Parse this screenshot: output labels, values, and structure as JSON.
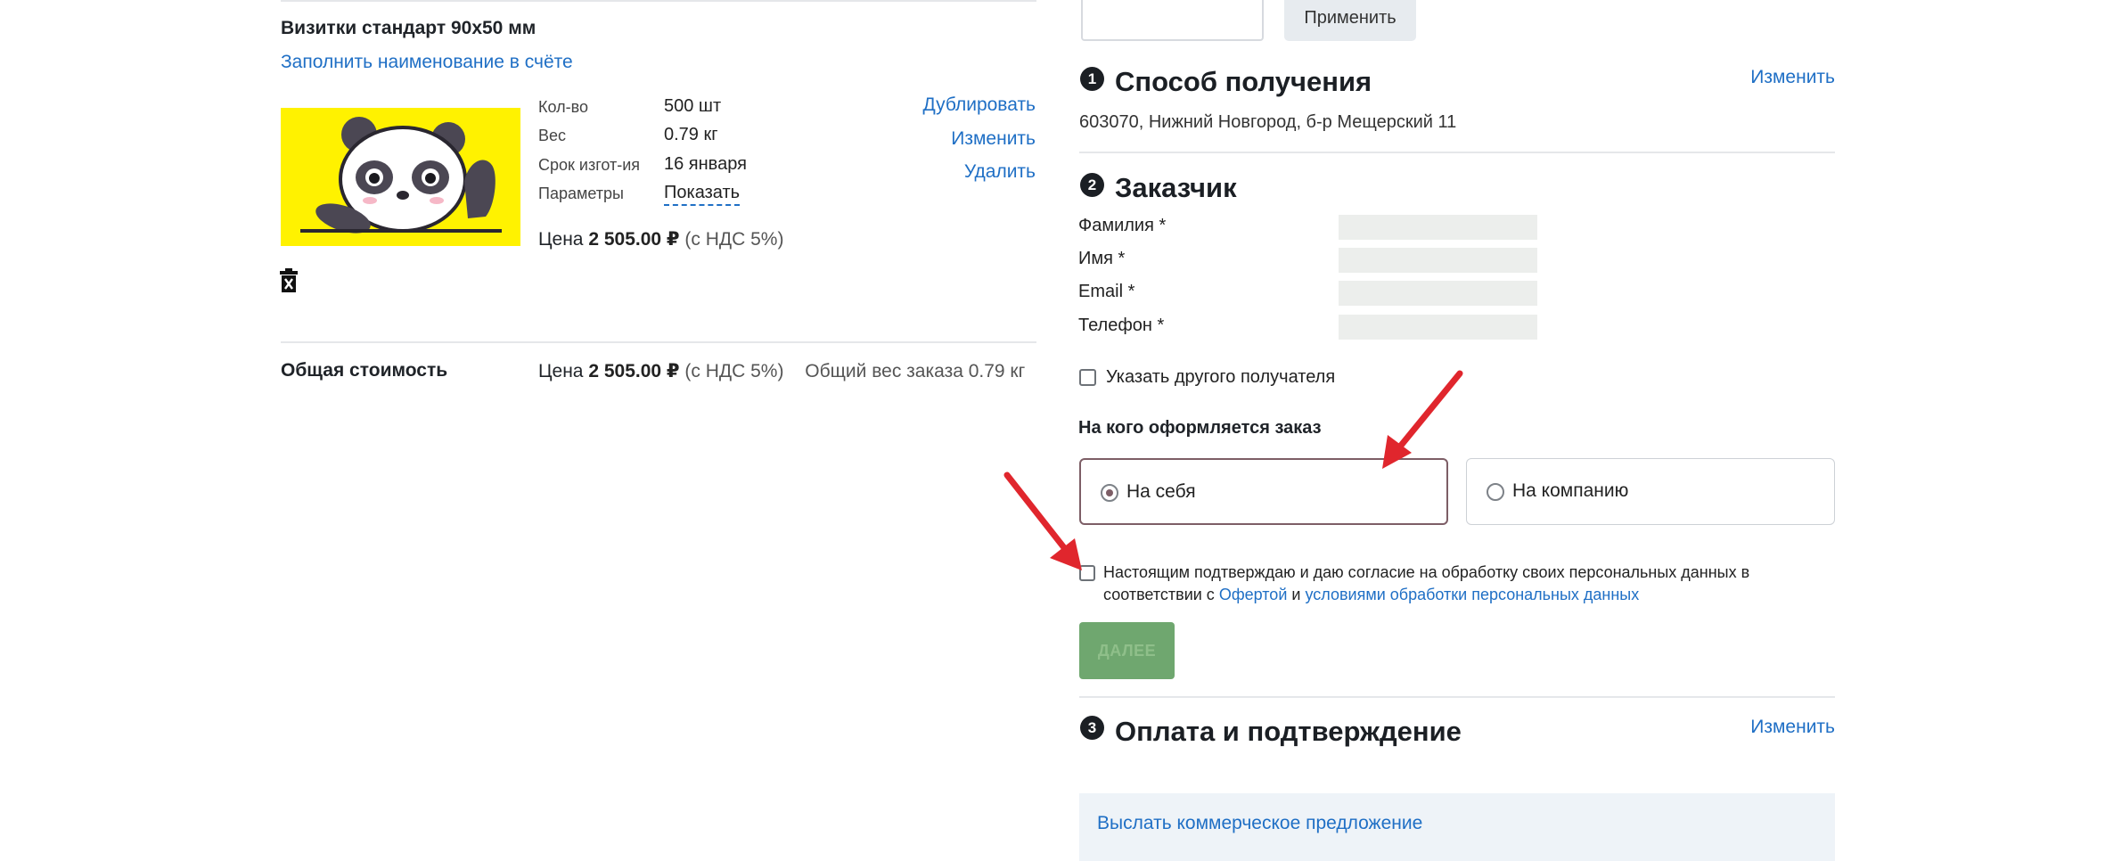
{
  "product": {
    "title": "Визитки стандарт 90х50 мм",
    "fill_name_link": "Заполнить наименование в счёте",
    "props": [
      {
        "label": "Кол-во",
        "value": "500 шт"
      },
      {
        "label": "Вес",
        "value": "0.79 кг"
      },
      {
        "label": "Срок изгот-ия",
        "value": "16 января"
      },
      {
        "label": "Параметры",
        "value": "Показать"
      }
    ],
    "actions": {
      "duplicate": "Дублировать",
      "edit": "Изменить",
      "delete": "Удалить"
    },
    "price_label": "Цена",
    "price_value": "2 505.00 ₽",
    "vat_note": "(с НДС 5%)"
  },
  "total": {
    "label": "Общая стоимость",
    "price_label": "Цена",
    "price_value": "2 505.00 ₽",
    "vat_note": "(с НДС 5%)",
    "weight_note": "Общий вес заказа 0.79 кг"
  },
  "promo": {
    "apply_button": "Применить"
  },
  "steps": [
    {
      "number": "1",
      "title": "Способ получения",
      "change_link": "Изменить"
    },
    {
      "number": "2",
      "title": "Заказчик"
    },
    {
      "number": "3",
      "title": "Оплата и подтверждение",
      "change_link": "Изменить"
    }
  ],
  "delivery": {
    "address": "603070, Нижний Новгород, б-р Мещерский 11"
  },
  "customer": {
    "fields": [
      {
        "label": "Фамилия *"
      },
      {
        "label": "Имя *"
      },
      {
        "label": "Email *"
      },
      {
        "label": "Телефон *"
      }
    ],
    "other_recipient": "Указать другого получателя",
    "who_title": "На кого оформляется заказ",
    "option_self": "На себя",
    "option_company": "На компанию",
    "selected": "На себя"
  },
  "consent": {
    "text_before": "Настоящим подтверждаю и даю согласие на обработку своих персональных данных в соответствии с",
    "offer_link": "Офертой",
    "and": "и",
    "terms_link": "условиями обработки персональных данных"
  },
  "next_button": "ДАЛЕЕ",
  "offer_request_link": "Выслать коммерческое предложение",
  "colors": {
    "accent": "#1f6fc5",
    "next_button": "#6fa76f",
    "arrow": "#e0262d",
    "thumb_bg": "#fff200"
  }
}
